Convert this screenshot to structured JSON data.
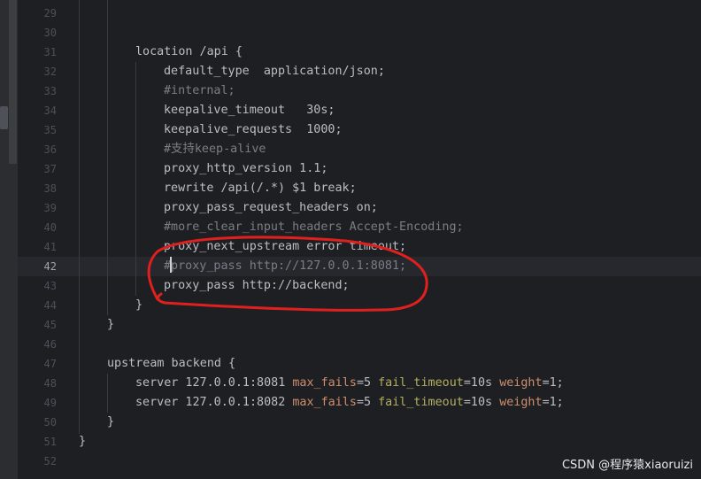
{
  "editor": {
    "current_line": 42,
    "lines": [
      {
        "number": "29",
        "indent": 0,
        "segments": []
      },
      {
        "number": "30",
        "indent": 0,
        "segments": []
      },
      {
        "number": "31",
        "indent": 2,
        "segments": [
          {
            "t": "location /api {",
            "c": "plain"
          }
        ]
      },
      {
        "number": "32",
        "indent": 3,
        "segments": [
          {
            "t": "default_type  application/json;",
            "c": "plain"
          }
        ]
      },
      {
        "number": "33",
        "indent": 3,
        "segments": [
          {
            "t": "#internal;",
            "c": "comment"
          }
        ]
      },
      {
        "number": "34",
        "indent": 3,
        "segments": [
          {
            "t": "keepalive_timeout   30s;",
            "c": "plain"
          }
        ]
      },
      {
        "number": "35",
        "indent": 3,
        "segments": [
          {
            "t": "keepalive_requests  1000;",
            "c": "plain"
          }
        ]
      },
      {
        "number": "36",
        "indent": 3,
        "segments": [
          {
            "t": "#支持keep-alive",
            "c": "comment"
          }
        ]
      },
      {
        "number": "37",
        "indent": 3,
        "segments": [
          {
            "t": "proxy_http_version 1.1;",
            "c": "plain"
          }
        ]
      },
      {
        "number": "38",
        "indent": 3,
        "segments": [
          {
            "t": "rewrite /api(/.*) $1 break;",
            "c": "plain"
          }
        ]
      },
      {
        "number": "39",
        "indent": 3,
        "segments": [
          {
            "t": "proxy_pass_request_headers on;",
            "c": "plain"
          }
        ]
      },
      {
        "number": "40",
        "indent": 3,
        "segments": [
          {
            "t": "#more_clear_input_headers Accept-Encoding;",
            "c": "comment"
          }
        ]
      },
      {
        "number": "41",
        "indent": 3,
        "segments": [
          {
            "t": "proxy_next_upstream ",
            "c": "plain"
          },
          {
            "t": "error timeout;",
            "c": "plain"
          }
        ]
      },
      {
        "number": "42",
        "indent": 3,
        "segments": [
          {
            "t": "#proxy_pass http://127.0.0.1:8081;",
            "c": "comment"
          }
        ]
      },
      {
        "number": "43",
        "indent": 3,
        "segments": [
          {
            "t": "proxy_pass http://backend;",
            "c": "plain"
          }
        ]
      },
      {
        "number": "44",
        "indent": 2,
        "segments": [
          {
            "t": "}",
            "c": "plain"
          }
        ]
      },
      {
        "number": "45",
        "indent": 1,
        "segments": [
          {
            "t": "}",
            "c": "plain"
          }
        ]
      },
      {
        "number": "46",
        "indent": 0,
        "segments": []
      },
      {
        "number": "47",
        "indent": 1,
        "segments": [
          {
            "t": "upstream backend {",
            "c": "plain"
          }
        ]
      },
      {
        "number": "48",
        "indent": 2,
        "segments": [
          {
            "t": "server 127.0.0.1:8081 ",
            "c": "plain"
          },
          {
            "t": "max_fails",
            "c": "attr"
          },
          {
            "t": "=5 ",
            "c": "plain"
          },
          {
            "t": "fail_timeout",
            "c": "attr2"
          },
          {
            "t": "=10s ",
            "c": "plain"
          },
          {
            "t": "weight",
            "c": "attr"
          },
          {
            "t": "=1;",
            "c": "plain"
          }
        ]
      },
      {
        "number": "49",
        "indent": 2,
        "segments": [
          {
            "t": "server 127.0.0.1:8082 ",
            "c": "plain"
          },
          {
            "t": "max_fails",
            "c": "attr"
          },
          {
            "t": "=5 ",
            "c": "plain"
          },
          {
            "t": "fail_timeout",
            "c": "attr2"
          },
          {
            "t": "=10s ",
            "c": "plain"
          },
          {
            "t": "weight",
            "c": "attr"
          },
          {
            "t": "=1;",
            "c": "plain"
          }
        ]
      },
      {
        "number": "50",
        "indent": 1,
        "segments": [
          {
            "t": "}",
            "c": "plain"
          }
        ]
      },
      {
        "number": "51",
        "indent": 0,
        "segments": [
          {
            "t": "}",
            "c": "plain"
          }
        ]
      },
      {
        "number": "52",
        "indent": 0,
        "segments": []
      }
    ]
  },
  "colors": {
    "background": "#1e1f22",
    "text": "#bcbec4",
    "comment": "#7a7e85",
    "attr": "#cf8e6d",
    "attr2": "#b3ae60",
    "annotation": "#e0201e"
  },
  "watermark": "CSDN @程序猿xiaoruizi"
}
